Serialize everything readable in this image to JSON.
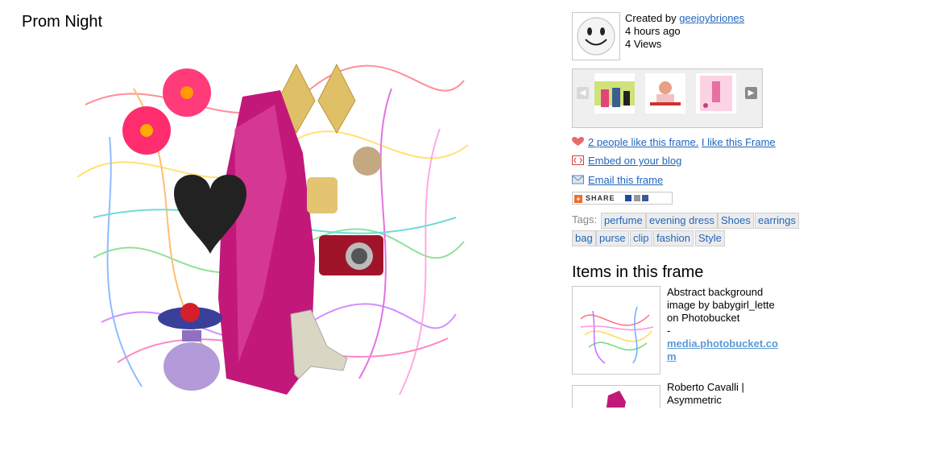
{
  "title": "Prom Night",
  "creator": {
    "created_prefix": "Created by ",
    "username": "geejoybriones",
    "time_ago": "4 hours ago",
    "views": "4 Views"
  },
  "actions": {
    "likes_link": "2 people like this frame.",
    "like_link": "I like this Frame",
    "embed_link": "Embed on your blog",
    "email_link": "Email this frame",
    "share_label": "SHARE"
  },
  "tags": {
    "label": "Tags:",
    "items": [
      "perfume",
      "evening dress",
      "Shoes",
      "earrings",
      "bag",
      "purse",
      "clip",
      "fashion",
      "Style"
    ]
  },
  "items_section": {
    "heading": "Items in this frame",
    "items": [
      {
        "title": "Abstract background image by babygirl_lette on Photobucket",
        "separator": "-",
        "link": "media.photobucket.com"
      },
      {
        "title": "Roberto Cavalli | Asymmetric"
      }
    ]
  },
  "icons": {
    "like": "heart-icon",
    "embed": "embed-icon",
    "email": "envelope-icon",
    "avatar": "smiley-face-icon"
  },
  "colors": {
    "link": "#2266bb",
    "tag_bg": "#ececec",
    "border": "#c8c8c8"
  }
}
